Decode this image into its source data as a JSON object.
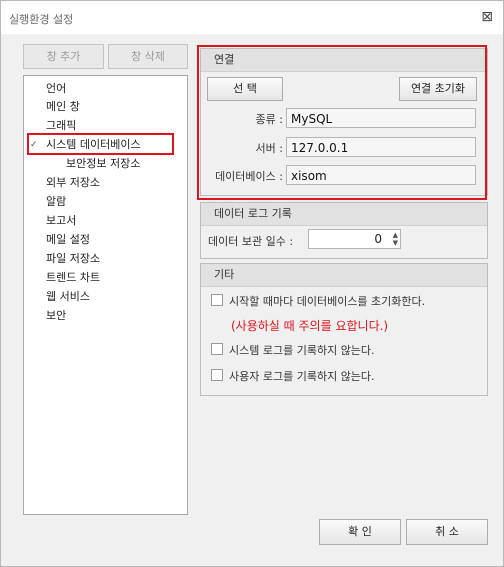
{
  "window": {
    "title": "실행환경 설정",
    "close_icon": "⊠"
  },
  "toolbar": {
    "add_label": "창 추가",
    "delete_label": "창 삭제"
  },
  "tree": {
    "items": [
      {
        "label": "언어"
      },
      {
        "label": "메인 창"
      },
      {
        "label": "그래픽"
      },
      {
        "label": "시스템 데이터베이스",
        "expanded": true
      },
      {
        "label": "보안정보 저장소",
        "child": true
      },
      {
        "label": "외부 저장소"
      },
      {
        "label": "알람"
      },
      {
        "label": "보고서"
      },
      {
        "label": "메일 설정"
      },
      {
        "label": "파일 저장소"
      },
      {
        "label": "트렌드 차트"
      },
      {
        "label": "웹 서비스"
      },
      {
        "label": "보안"
      }
    ]
  },
  "connection": {
    "header": "연결",
    "select_label": "선 택",
    "reset_label": "연결 초기화",
    "type_label": "종류 :",
    "type_value": "MySQL",
    "server_label": "서버 :",
    "server_value": "127.0.0.1",
    "db_label": "데이터베이스 :",
    "db_value": "xisom"
  },
  "datalog": {
    "header": "데이터 로그 기록",
    "retention_label": "데이터 보관 일수 :",
    "retention_value": "0"
  },
  "misc": {
    "header": "기타",
    "init_db_label": "시작할 때마다 데이터베이스를 초기화한다.",
    "warning": "(사용하실 때 주의를 요합니다.)",
    "no_system_log_label": "시스템 로그를 기록하지 않는다.",
    "no_user_log_label": "사용자 로그를 기록하지 않는다.",
    "init_db_checked": false,
    "no_system_log_checked": false,
    "no_user_log_checked": false
  },
  "footer": {
    "ok_label": "확 인",
    "cancel_label": "취 소"
  },
  "colors": {
    "highlight": "#e0141d",
    "warning_text": "#e0141d"
  }
}
